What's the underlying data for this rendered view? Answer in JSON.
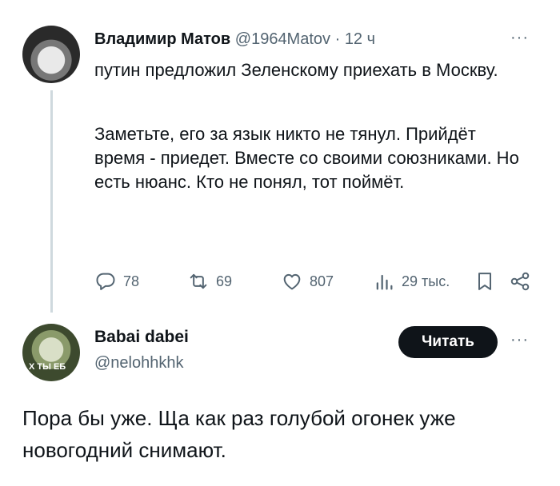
{
  "tweet1": {
    "author_name": "Владимир Матов",
    "handle": "@1964Matov",
    "separator": " · ",
    "time": "12 ч",
    "more": "···",
    "lines": [
      "путин предложил Зеленскому приехать в Москву.",
      "Заметьте, его за язык никто не тянул. Прийдёт время - приедет. Вместе со своими союзниками. Но есть нюанс. Кто не понял, тот поймёт."
    ],
    "stats": {
      "replies": "78",
      "retweets": "69",
      "likes": "807",
      "views": "29 тыс."
    },
    "icons": [
      "reply-icon",
      "retweet-icon",
      "like-icon",
      "views-icon",
      "bookmark-icon",
      "share-icon"
    ]
  },
  "tweet2": {
    "author_name": "Babai dabei",
    "handle": "@nelohhkhk",
    "avatar_text": "Х ТЫ ЕБ",
    "follow_label": "Читать",
    "more": "···",
    "text": "Пора бы уже. Ща как раз голубой огонек уже новогодний снимают."
  },
  "colors": {
    "text": "#0f1419",
    "secondary": "#536471",
    "thread_line": "#cfd9de",
    "button_bg": "#0f1419"
  }
}
